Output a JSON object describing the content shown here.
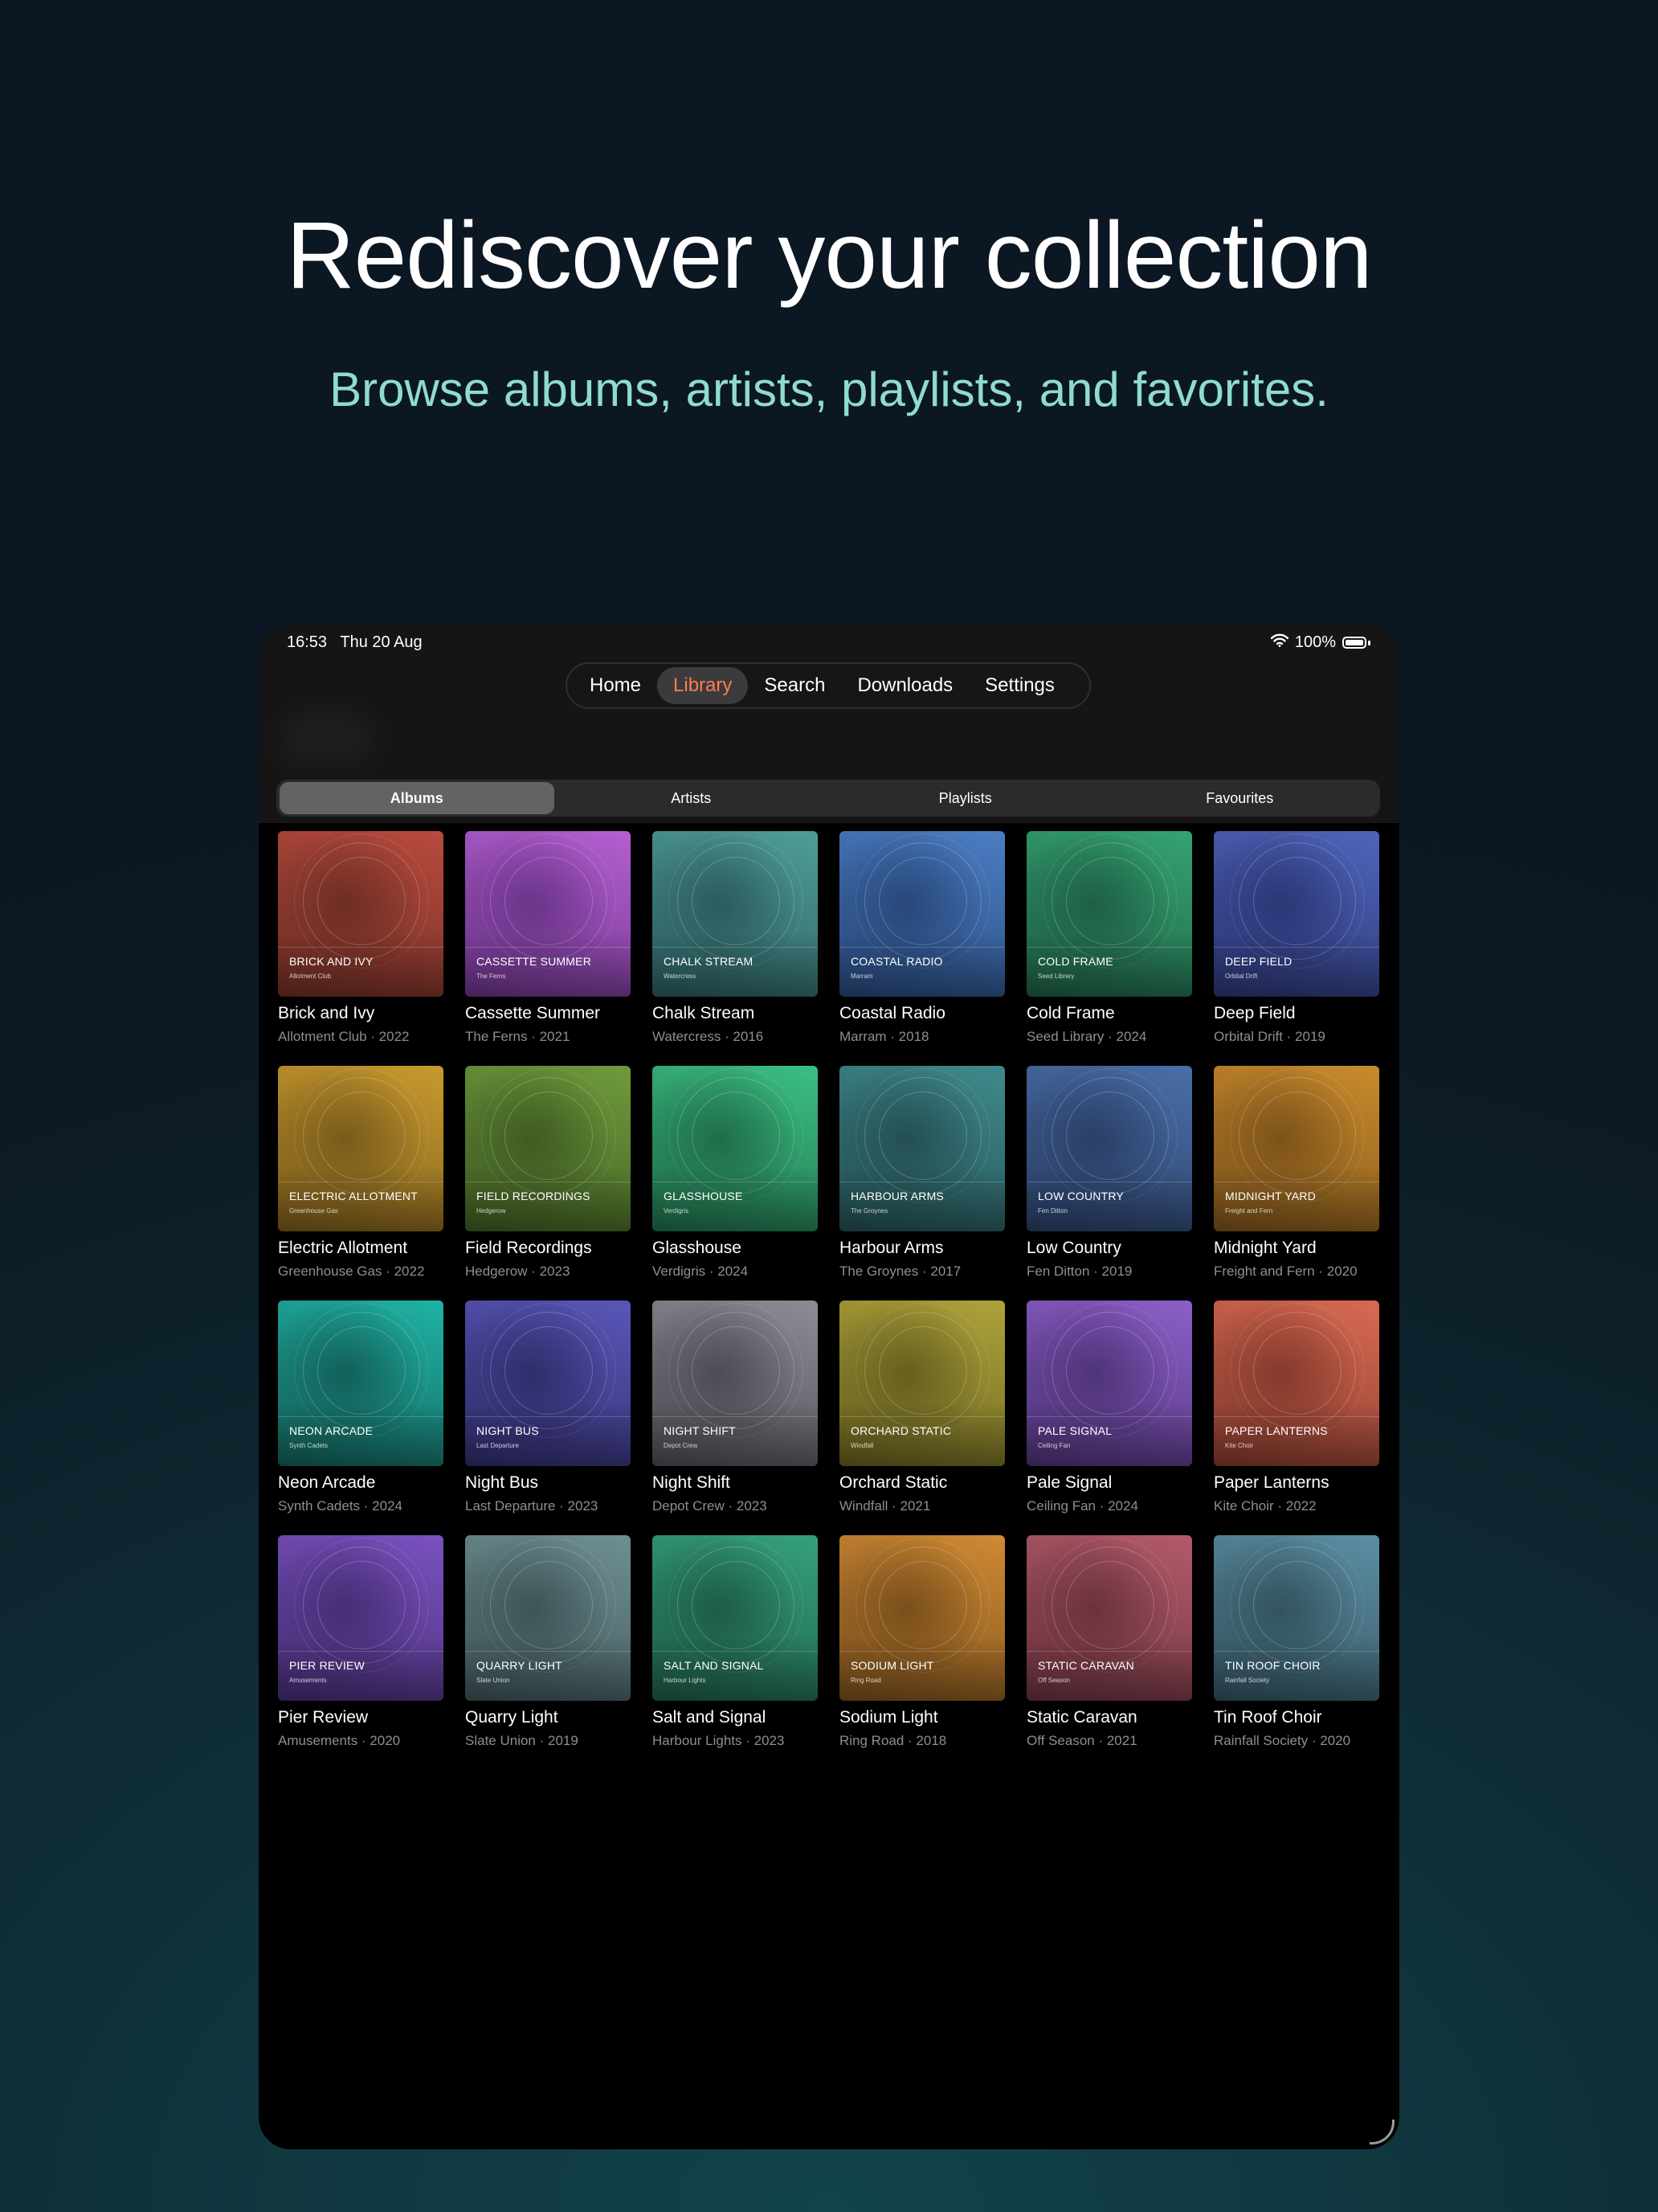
{
  "headline": "Rediscover your collection",
  "subheadline": "Browse albums, artists, playlists, and favorites.",
  "status_bar": {
    "time": "16:53",
    "date": "Thu 20 Aug",
    "battery": "100%"
  },
  "nav": {
    "tabs": [
      "Home",
      "Library",
      "Search",
      "Downloads",
      "Settings"
    ],
    "active": "Library"
  },
  "segments": {
    "items": [
      "Albums",
      "Artists",
      "Playlists",
      "Favourites"
    ],
    "active": "Albums"
  },
  "colors": {
    "accent": "#ff7d45",
    "subheadline": "#8fdccd"
  },
  "albums": [
    {
      "title": "Brick and Ivy",
      "artist": "Allotment Club",
      "year": "2022",
      "c1": "#b94a3e",
      "c2": "#6e2e24",
      "meta": "Allotment Club · 2022"
    },
    {
      "title": "Cassette Summer",
      "artist": "The Ferns",
      "year": "2021",
      "c1": "#b45fd1",
      "c2": "#6b3489",
      "meta": "The Ferns · 2021"
    },
    {
      "title": "Chalk Stream",
      "artist": "Watercress",
      "year": "2016",
      "c1": "#4f9d98",
      "c2": "#2b5b5e",
      "meta": "Watercress · 2016"
    },
    {
      "title": "Coastal Radio",
      "artist": "Marram",
      "year": "2018",
      "c1": "#4b7ec4",
      "c2": "#28477a",
      "meta": "Marram · 2018"
    },
    {
      "title": "Cold Frame",
      "artist": "Seed Library",
      "year": "2024",
      "c1": "#35a372",
      "c2": "#1e5f45",
      "meta": "Seed Library · 2024"
    },
    {
      "title": "Deep Field",
      "artist": "Orbital Drift",
      "year": "2019",
      "c1": "#4f64b9",
      "c2": "#2b3675",
      "meta": "Orbital Drift · 2019"
    },
    {
      "title": "Electric Allotment",
      "artist": "Greenhouse Gas",
      "year": "2022",
      "c1": "#c89a2e",
      "c2": "#7a5b1b",
      "meta": "Greenhouse Gas · 2022"
    },
    {
      "title": "Field Recordings",
      "artist": "Hedgerow",
      "year": "2023",
      "c1": "#6f9a3c",
      "c2": "#3f5c22",
      "meta": "Hedgerow · 2023"
    },
    {
      "title": "Glasshouse",
      "artist": "Verdigris",
      "year": "2024",
      "c1": "#3bbf83",
      "c2": "#1f6d4a",
      "meta": "Verdigris · 2024"
    },
    {
      "title": "Harbour Arms",
      "artist": "The Groynes",
      "year": "2017",
      "c1": "#3f8a8c",
      "c2": "#244f53",
      "meta": "The Groynes · 2017"
    },
    {
      "title": "Low Country",
      "artist": "Fen Ditton",
      "year": "2019",
      "c1": "#4a6ea8",
      "c2": "#2a3f66",
      "meta": "Fen Ditton · 2019"
    },
    {
      "title": "Midnight Yard",
      "artist": "Freight and Fern",
      "year": "2020",
      "c1": "#c98b2c",
      "c2": "#7d531a",
      "meta": "Freight and Fern · 2020"
    },
    {
      "title": "Neon Arcade",
      "artist": "Synth Cadets",
      "year": "2024",
      "c1": "#1fb3a4",
      "c2": "#13605a",
      "meta": "Synth Cadets · 2024"
    },
    {
      "title": "Night Bus",
      "artist": "Last Departure",
      "year": "2023",
      "c1": "#5a56b8",
      "c2": "#302d6c",
      "meta": "Last Departure · 2023"
    },
    {
      "title": "Night Shift",
      "artist": "Depot Crew",
      "year": "2023",
      "c1": "#8c8c94",
      "c2": "#4c4c54",
      "meta": "Depot Crew · 2023"
    },
    {
      "title": "Orchard Static",
      "artist": "Windfall",
      "year": "2021",
      "c1": "#aea33a",
      "c2": "#66601f",
      "meta": "Windfall · 2021"
    },
    {
      "title": "Pale Signal",
      "artist": "Ceiling Fan",
      "year": "2024",
      "c1": "#8b5fc8",
      "c2": "#4f3479",
      "meta": "Ceiling Fan · 2024"
    },
    {
      "title": "Paper Lanterns",
      "artist": "Kite Choir",
      "year": "2022",
      "c1": "#d86a52",
      "c2": "#853a2d",
      "meta": "Kite Choir · 2022"
    },
    {
      "title": "Pier Review",
      "artist": "Amusements",
      "year": "2020",
      "c1": "#7a52c0",
      "c2": "#462d75",
      "meta": "Amusements · 2020"
    },
    {
      "title": "Quarry Light",
      "artist": "Slate Union",
      "year": "2019",
      "c1": "#6f8f92",
      "c2": "#3e5457",
      "meta": "Slate Union · 2019"
    },
    {
      "title": "Salt and Signal",
      "artist": "Harbour Lights",
      "year": "2023",
      "c1": "#35a07c",
      "c2": "#1d5c48",
      "meta": "Harbour Lights · 2023"
    },
    {
      "title": "Sodium Light",
      "artist": "Ring Road",
      "year": "2018",
      "c1": "#cf8a34",
      "c2": "#7a4f1c",
      "meta": "Ring Road · 2018"
    },
    {
      "title": "Static Caravan",
      "artist": "Off Season",
      "year": "2021",
      "c1": "#b35a6a",
      "c2": "#6a323d",
      "meta": "Off Season · 2021"
    },
    {
      "title": "Tin Roof Choir",
      "artist": "Rainfall Society",
      "year": "2020",
      "c1": "#5c8ea3",
      "c2": "#33535f",
      "meta": "Rainfall Society · 2020"
    }
  ]
}
